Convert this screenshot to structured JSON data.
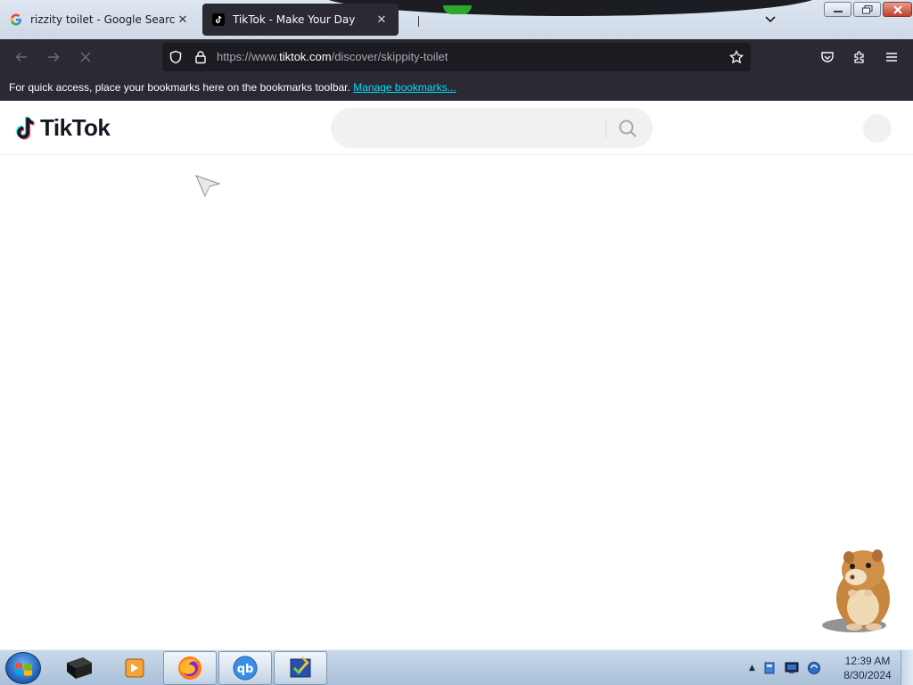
{
  "tabs": [
    {
      "title": "rizzity toilet - Google Search",
      "favicon": "google-g-icon",
      "active": false,
      "close": "✕"
    },
    {
      "title": "TikTok - Make Your Day",
      "favicon": "tiktok-icon",
      "active": true,
      "close": "✕"
    }
  ],
  "address_bar": {
    "url_prefix": "https://www.",
    "url_host": "tiktok.com",
    "url_path": "/discover/skippity-toilet"
  },
  "bookmarks_bar": {
    "message": "For quick access, place your bookmarks here on the bookmarks toolbar.",
    "link_label": "Manage bookmarks..."
  },
  "tiktok": {
    "logo_text": "TikTok",
    "search_placeholder": ""
  },
  "taskbar": {
    "time": "12:39 AM",
    "date": "8/30/2024",
    "tray_expand": "▲"
  },
  "colors": {
    "tab_active_bg": "#2b2a33",
    "toolbar_bg": "#2b2a33",
    "urlbar_bg": "#1c1b22",
    "link": "#00ddff",
    "tiktok_text": "#161823",
    "tiktok_cyan": "#25f4ee",
    "tiktok_red": "#fe2c55"
  }
}
